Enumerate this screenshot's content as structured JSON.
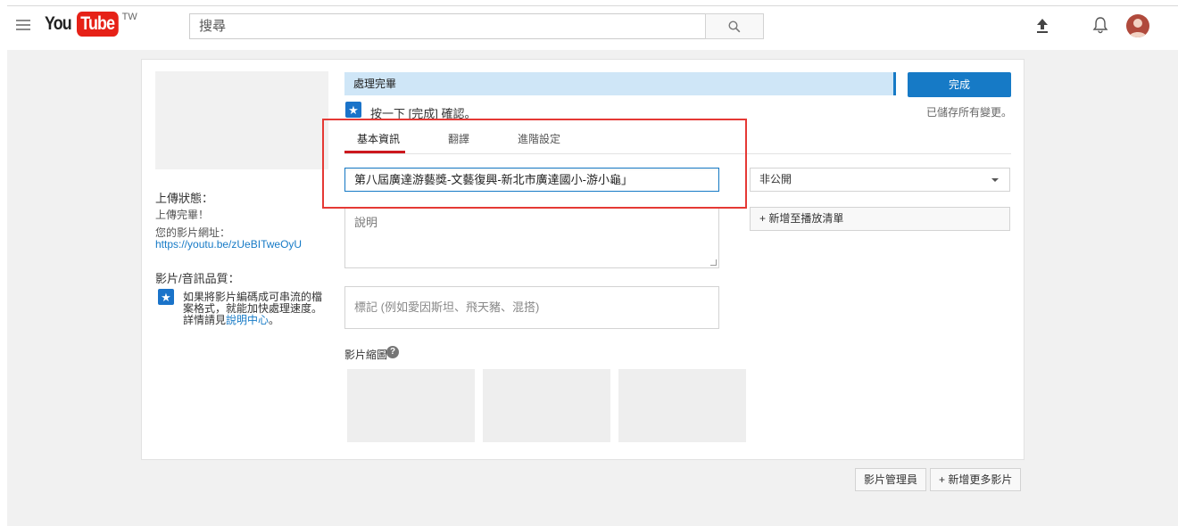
{
  "masthead": {
    "logo_you": "You",
    "logo_tube": "Tube",
    "logo_region": "TW",
    "search_placeholder": "搜尋",
    "icons": [
      "menu-icon",
      "search-icon",
      "upload-icon",
      "bell-icon",
      "avatar"
    ]
  },
  "sidebar": {
    "upload_status_heading": "上傳狀態：",
    "upload_status_text": "上傳完畢！",
    "video_url_label": "您的影片網址：",
    "video_url": "https://youtu.be/zUeBITweOyU",
    "quality_heading": "影片/音訊品質：",
    "quality_note": "如果將影片編碼成可串流的檔案格式，就能加快處理速度。詳情請見",
    "quality_link": "說明中心",
    "quality_end": "。"
  },
  "progress": {
    "status": "處理完畢",
    "confirm_text": "按一下 [完成] 確認。",
    "done_label": "完成",
    "saved_note": "已儲存所有變更。"
  },
  "tabs": [
    {
      "label": "基本資訊",
      "active": true
    },
    {
      "label": "翻譯",
      "active": false
    },
    {
      "label": "進階設定",
      "active": false
    }
  ],
  "form": {
    "title_value": "第八屆廣達游藝獎-文藝復興-新北市廣達國小-游小龜」",
    "description_placeholder": "說明",
    "tags_placeholder": "標記 (例如愛因斯坦、飛天豬、混搭)",
    "privacy_value": "非公開",
    "playlist_label": "+ 新增至播放清單",
    "thumbnails_label": "影片縮圖"
  },
  "footer": {
    "video_manager": "影片管理員",
    "add_more": "+ 新增更多影片"
  },
  "colors": {
    "accent": "#167ac6",
    "progress_bg": "#cfe6f7",
    "brand_red": "#e62117",
    "tab_underline": "#cc181e",
    "highlight": "#e53935"
  }
}
